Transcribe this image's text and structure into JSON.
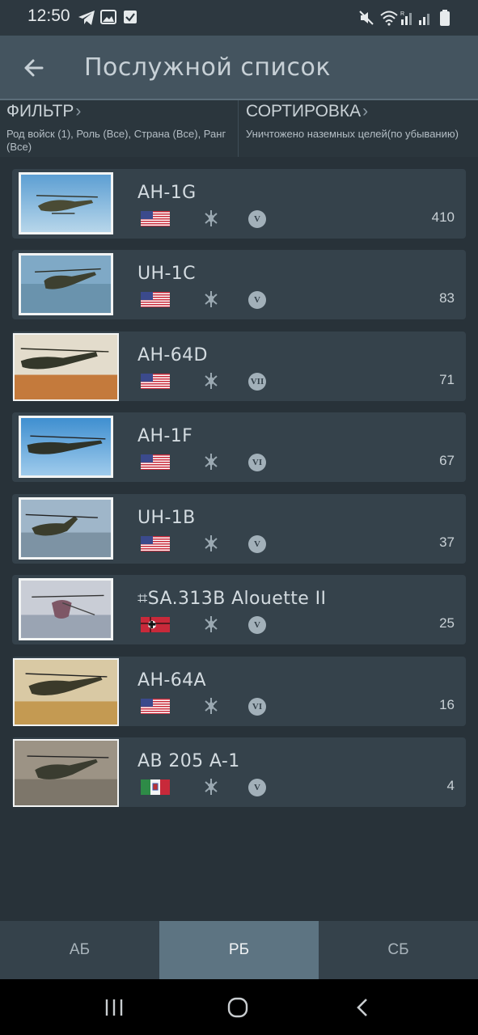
{
  "status_bar": {
    "time": "12:50"
  },
  "header": {
    "title": "Послужной список"
  },
  "filter": {
    "label": "ФИЛЬТР",
    "description": "Род войск (1), Роль (Все), Страна (Все), Ранг (Все)"
  },
  "sort": {
    "label": "СОРТИРОВКА",
    "description": "Уничтожено наземных целей(по убыванию)"
  },
  "vehicles": [
    {
      "name": "AH-1G",
      "country": "usa",
      "rank": "V",
      "count": "410"
    },
    {
      "name": "UH-1C",
      "country": "usa",
      "rank": "V",
      "count": "83"
    },
    {
      "name": "AH-64D",
      "country": "usa",
      "rank": "VII",
      "count": "71"
    },
    {
      "name": "AH-1F",
      "country": "usa",
      "rank": "VI",
      "count": "67"
    },
    {
      "name": "UH-1B",
      "country": "usa",
      "rank": "V",
      "count": "37"
    },
    {
      "name": "⌗SA.313B Alouette II",
      "country": "germany",
      "rank": "V",
      "count": "25"
    },
    {
      "name": "AH-64A",
      "country": "usa",
      "rank": "VI",
      "count": "16"
    },
    {
      "name": "AB 205 A-1",
      "country": "italy",
      "rank": "V",
      "count": "4"
    }
  ],
  "tabs": [
    {
      "label": "АБ",
      "active": false
    },
    {
      "label": "РБ",
      "active": true
    },
    {
      "label": "СБ",
      "active": false
    }
  ],
  "colors": {
    "background": "#283239",
    "card": "#35424b",
    "app_bar": "#44545f",
    "active_tab": "#5d7482"
  }
}
